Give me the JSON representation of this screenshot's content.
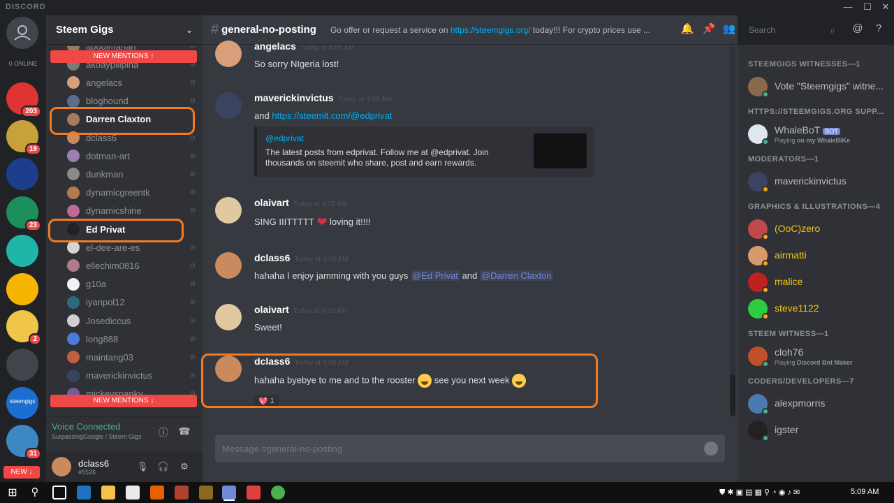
{
  "window": {
    "brand": "DISCORD",
    "minimize": "—",
    "maximize": "☐",
    "close": "✕"
  },
  "rail": {
    "online": "0 ONLINE",
    "servers": [
      {
        "color": "#e03434",
        "badge": "203"
      },
      {
        "color": "#c9a13a",
        "badge": "19"
      },
      {
        "color": "#1d3e8c",
        "badge": ""
      },
      {
        "color": "#1c8f5c",
        "badge": "23"
      },
      {
        "color": "#1fb5a8",
        "badge": ""
      },
      {
        "color": "#f7b500",
        "badge": ""
      },
      {
        "color": "#f0c64a",
        "badge": "2"
      },
      {
        "color": "#40444b",
        "badge": ""
      },
      {
        "color": "#1a6fd1",
        "badge": "",
        "label": "steemgigs"
      },
      {
        "color": "#3b88c3",
        "badge": "31"
      }
    ],
    "new_label": "NEW ↓"
  },
  "guild": {
    "name": "Steem Gigs",
    "chevron": "⌄"
  },
  "voice": {
    "new_mentions_top": "NEW MENTIONS ↑",
    "new_mentions_bottom": "NEW MENTIONS ↓",
    "users": [
      {
        "name": "abdulmanan",
        "color": "#9c7a5b"
      },
      {
        "name": "akoaypilipina",
        "color": "#7a7a7a"
      },
      {
        "name": "angelacs",
        "color": "#d8a07a"
      },
      {
        "name": "bloghound",
        "color": "#5a6e8a"
      },
      {
        "name": "Darren Claxton",
        "color": "#a67b5b",
        "hl": true
      },
      {
        "name": "dclass6",
        "color": "#c98b5e"
      },
      {
        "name": "dotman-art",
        "color": "#9a7fb0"
      },
      {
        "name": "dunkman",
        "color": "#8a8a8a"
      },
      {
        "name": "dynamicgreentk",
        "color": "#b57b4a"
      },
      {
        "name": "dynamicshine",
        "color": "#bc6b9a"
      },
      {
        "name": "Ed Privat",
        "color": "#222222",
        "hl": true
      },
      {
        "name": "el-dee-are-es",
        "color": "#d4d4d4"
      },
      {
        "name": "ellechim0816",
        "color": "#b07a8a"
      },
      {
        "name": "g10a",
        "color": "#f2f2f2"
      },
      {
        "name": "iyanpol12",
        "color": "#2c6b7d"
      },
      {
        "name": "Josediccus",
        "color": "#cfcfcf"
      },
      {
        "name": "long888",
        "color": "#4a7bd8"
      },
      {
        "name": "maintang03",
        "color": "#c06040"
      },
      {
        "name": "maverickinvictus",
        "color": "#3a4460"
      },
      {
        "name": "mickeyspanky",
        "color": "#7a5a9a"
      }
    ]
  },
  "voicebar": {
    "status": "Voice Connected",
    "sub": "SurpassingGoogle / Steem Gigs",
    "info_icon": "ⓘ",
    "disconnect_icon": "☎"
  },
  "userbar": {
    "name": "dclass6",
    "tag": "#5526",
    "mic": "🎙",
    "headset": "🎧",
    "settings": "⚙"
  },
  "chat_header": {
    "channel": "general-no-posting",
    "topic_pre": "Go offer or request a service on ",
    "topic_link": "https://steemgigs.org/",
    "topic_post": " today!!! For crypto prices use ..."
  },
  "toolbar": {
    "bell": "🔔",
    "pin": "📌",
    "members": "👥",
    "search_placeholder": "Search",
    "search_icon": "⌕",
    "at": "@",
    "help": "?"
  },
  "messages": [
    {
      "user": "angelacs",
      "time": "Today at 4:08 AM",
      "text": "So sorry NIgeria lost!",
      "avatar": "#d8a07a"
    },
    {
      "user": "maverickinvictus",
      "time": "Today at 4:08 AM",
      "text_pre": "and ",
      "link": "https://steemit.com/@edprivat",
      "avatar": "#3a4460",
      "embed": {
        "author": "@edprivat",
        "desc": "The latest posts from edprivat. Follow me at @edprivat. Join thousands on steemit who share, post and earn rewards."
      }
    },
    {
      "user": "olaivart",
      "time": "Today at 4:09 AM",
      "text_pre": "SING IIITTTTT ",
      "heart": "❤",
      "text_post": " loving it!!!!",
      "avatar": "#e0c8a0"
    },
    {
      "user": "dclass6",
      "time": "Today at 4:09 AM",
      "text_pre": "hahaha I enjoy jamming with you guys ",
      "mention1": "@Ed Privat",
      "mid": "  and  ",
      "mention2": "@Darren Claxton",
      "avatar": "#c98b5e"
    },
    {
      "user": "olaivart",
      "time": "Today at 4:09 AM",
      "text": "Sweet!",
      "avatar": "#e0c8a0"
    },
    {
      "user": "dclass6",
      "time": "Today at 4:09 AM",
      "text_pre": "hahaha byebye to me and to the rooster ",
      "text_post": " see you next week ",
      "reaction_emoji": "💖",
      "reaction_count": "1",
      "avatar": "#c98b5e"
    }
  ],
  "composer": {
    "placeholder": "Message #general-no-posting"
  },
  "members": {
    "groups": [
      {
        "title": "STEEMGIGS WITNESSES—1",
        "items": [
          {
            "name": "Vote \"Steemgigs\" witne...",
            "color": "#8a6a4a",
            "dot": "#43b581"
          }
        ]
      },
      {
        "title": "HTTPS://STEEMGIGS.ORG SUPP...",
        "items": [
          {
            "name": "WhaleBoT",
            "bot": "BOT",
            "sub_pre": "Playing ",
            "sub_game": "on my WhaleBiKe",
            "color": "#e0e6ee",
            "dot": "#43b581"
          }
        ]
      },
      {
        "title": "MODERATORS—1",
        "items": [
          {
            "name": "maverickinvictus",
            "color": "#3a4460",
            "dot": "#faa61a"
          }
        ]
      },
      {
        "title": "GRAPHICS & ILLUSTRATIONS—4",
        "items": [
          {
            "name": "(OoC)zero",
            "color": "#c04a4a",
            "dot": "#faa61a",
            "nameColor": "#f1c40f"
          },
          {
            "name": "airmatti",
            "color": "#d89a6a",
            "dot": "#faa61a",
            "nameColor": "#f1c40f"
          },
          {
            "name": "malice",
            "color": "#c02020",
            "dot": "#faa61a",
            "nameColor": "#f1c40f"
          },
          {
            "name": "steve1122",
            "color": "#2ecc40",
            "dot": "#faa61a",
            "nameColor": "#f1c40f"
          }
        ]
      },
      {
        "title": "STEEM WITNESS—1",
        "items": [
          {
            "name": "cloh76",
            "sub_pre": "Playing ",
            "sub_game": "Discord Bot Maker",
            "color": "#c0502a",
            "dot": "#43b581"
          }
        ]
      },
      {
        "title": "CODERS/DEVELOPERS—7",
        "items": [
          {
            "name": "alexpmorris",
            "color": "#4a7ab0",
            "dot": "#43b581"
          },
          {
            "name": "igster",
            "color": "#222222",
            "dot": "#43b581"
          }
        ]
      }
    ]
  },
  "taskbar": {
    "clock": "5:09 AM",
    "start_icon": "⊞",
    "search_icon": "⚲"
  }
}
